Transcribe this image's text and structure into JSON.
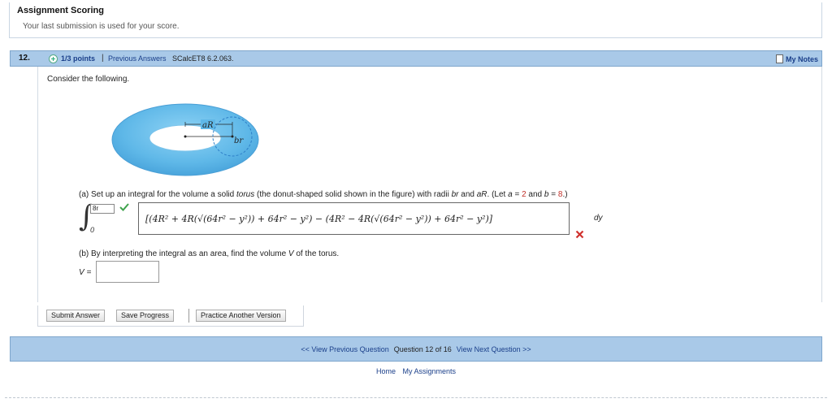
{
  "scoring": {
    "title": "Assignment Scoring",
    "subtitle": "Your last submission is used for your score."
  },
  "question": {
    "number": "12.",
    "points": "1/3 points",
    "separator": "|",
    "previous_answers": "Previous Answers",
    "code": "SCalcET8 6.2.063.",
    "my_notes": "My Notes",
    "intro": "Consider the following."
  },
  "figure": {
    "label_aR": "aR",
    "label_br": "br",
    "color": "#5fb8e8"
  },
  "part_a": {
    "prefix": "(a) Set up an integral for the volume a solid ",
    "torus": "torus",
    "middle": " (the donut-shaped solid shown in the figure) with radii ",
    "br": "br",
    "and": " and ",
    "aR": "aR",
    "let": ". (Let ",
    "a_var": "a",
    "a_eq": " = ",
    "a_val": "2",
    "and_b": " and ",
    "b_var": "b",
    "b_eq": " = ",
    "b_val": "8",
    "end": ".)",
    "upper_limit": "8r",
    "lower_limit": "0",
    "integrand": "[(4R² + 4R(√(64r² − y²)) + 64r² − y²) − (4R² − 4R(√(64r² − y²)) + 64r² − y²)]",
    "dy": "dy",
    "upper_correct": true,
    "integrand_correct": false
  },
  "part_b": {
    "prefix": "(b) By interpreting the integral as an area, find the volume ",
    "V": "V",
    "suffix": " of the torus.",
    "v_label": "V =",
    "v_value": ""
  },
  "buttons": {
    "submit": "Submit Answer",
    "save": "Save Progress",
    "practice": "Practice Another Version"
  },
  "nav": {
    "prev": "<< View Previous Question",
    "status": "Question 12 of 16",
    "next": "View Next Question >>"
  },
  "footer": {
    "home": "Home",
    "assignments": "My Assignments"
  }
}
